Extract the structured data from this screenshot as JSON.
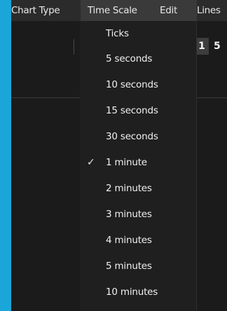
{
  "menubar": {
    "items": [
      {
        "label": "Chart Type"
      },
      {
        "label": "Time Scale"
      },
      {
        "label": "Edit"
      },
      {
        "label": "Lines"
      }
    ]
  },
  "toolbar": {
    "icons": [
      "notes-icon",
      "bell-icon"
    ],
    "page_buttons": [
      "1",
      "5"
    ]
  },
  "time_scale_menu": {
    "items": [
      {
        "label": "Ticks",
        "checked": false
      },
      {
        "label": "5 seconds",
        "checked": false
      },
      {
        "label": "10 seconds",
        "checked": false
      },
      {
        "label": "15 seconds",
        "checked": false
      },
      {
        "label": "30 seconds",
        "checked": false
      },
      {
        "label": "1 minute",
        "checked": true
      },
      {
        "label": "2 minutes",
        "checked": false
      },
      {
        "label": "3 minutes",
        "checked": false
      },
      {
        "label": "4 minutes",
        "checked": false
      },
      {
        "label": "5 minutes",
        "checked": false
      },
      {
        "label": "10 minutes",
        "checked": false
      }
    ],
    "check_glyph": "✓"
  },
  "colors": {
    "accent": "#1ba6d9",
    "background": "#1b1b1b",
    "menubar": "#2b2b2b"
  }
}
